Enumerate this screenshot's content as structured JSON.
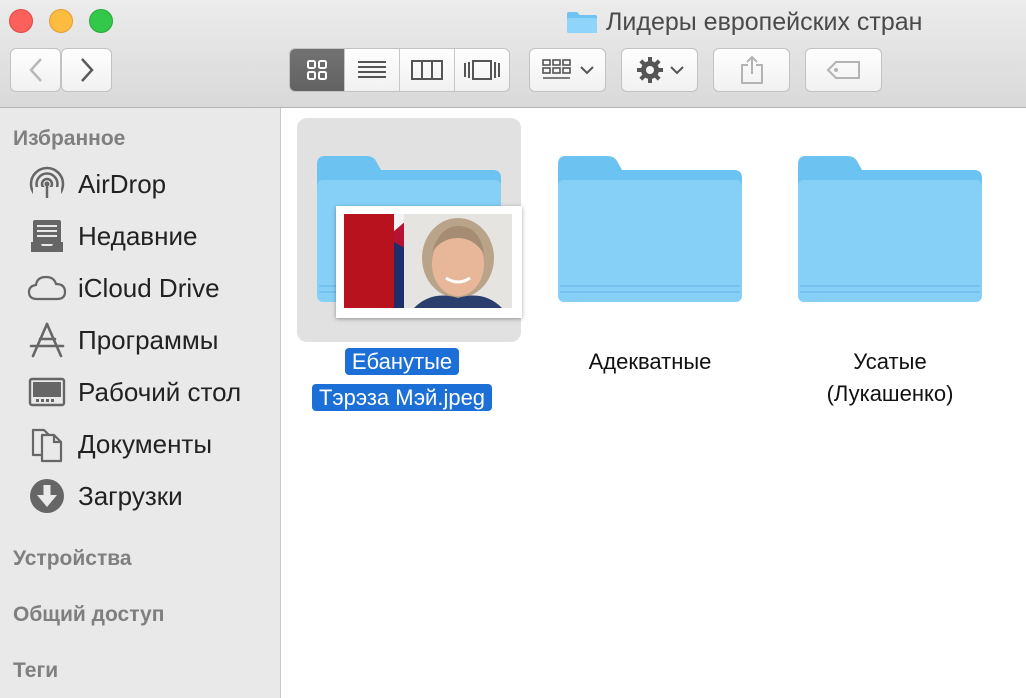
{
  "window": {
    "title": "Лидеры европейских стран"
  },
  "toolbar": {
    "back": "back",
    "forward": "forward",
    "views": [
      "icons",
      "list",
      "columns",
      "cover-flow"
    ],
    "active_view": "icons"
  },
  "sidebar": {
    "sections": {
      "favorites": "Избранное",
      "devices": "Устройства",
      "shared": "Общий доступ",
      "tags": "Теги"
    },
    "items": [
      {
        "label": "AirDrop",
        "icon": "airdrop-icon"
      },
      {
        "label": "Недавние",
        "icon": "recents-icon"
      },
      {
        "label": "iCloud Drive",
        "icon": "cloud-icon"
      },
      {
        "label": "Программы",
        "icon": "applications-icon"
      },
      {
        "label": "Рабочий стол",
        "icon": "desktop-icon"
      },
      {
        "label": "Документы",
        "icon": "documents-icon"
      },
      {
        "label": "Загрузки",
        "icon": "downloads-icon"
      }
    ]
  },
  "files": [
    {
      "line1": "Ебанутые",
      "line2": "Тэрэза Мэй.jpeg",
      "selected": true
    },
    {
      "line1": "Адекватные",
      "line2": ""
    },
    {
      "line1": "Усатые",
      "line2": "(Лукашенко)"
    }
  ],
  "colors": {
    "folder": "#7ccdf7",
    "selection": "#1b6fd6",
    "sidebar": "#e9e9e9"
  }
}
